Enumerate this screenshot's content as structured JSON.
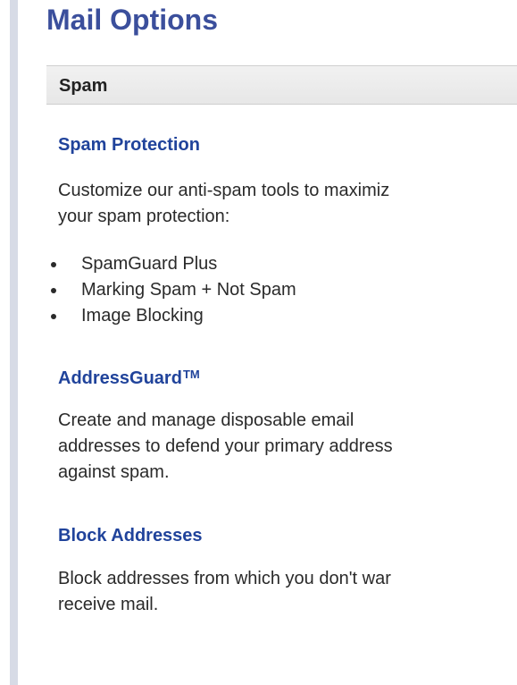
{
  "page": {
    "title": "Mail Options"
  },
  "section": {
    "label": "Spam"
  },
  "spam_protection": {
    "heading": "Spam Protection",
    "description_line1": "Customize our anti-spam tools to maximiz",
    "description_line2": "your spam protection:",
    "items": [
      "SpamGuard Plus",
      "Marking Spam + Not Spam",
      "Image Blocking"
    ]
  },
  "address_guard": {
    "heading": "AddressGuard",
    "trademark": "TM",
    "description_line1": "Create and manage disposable email",
    "description_line2": "addresses to defend your primary address",
    "description_line3": "against spam."
  },
  "block_addresses": {
    "heading": "Block Addresses",
    "description_line1": "Block addresses from which you don't war",
    "description_line2": "receive mail."
  }
}
